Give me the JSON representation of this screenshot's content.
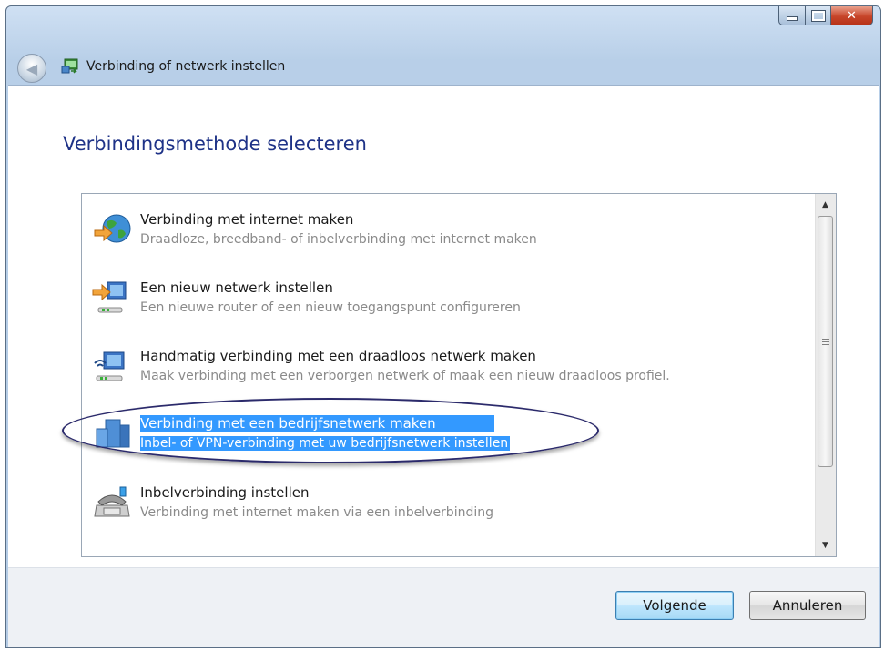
{
  "window": {
    "title": "Verbinding of netwerk instellen",
    "caption_buttons": [
      "minimize",
      "maximize",
      "close"
    ]
  },
  "header": {
    "back_icon": "back-arrow-icon",
    "wizard_icon": "network-setup-icon"
  },
  "main": {
    "heading": "Verbindingsmethode selecteren",
    "options": [
      {
        "title": "Verbinding met internet maken",
        "description": "Draadloze, breedband- of inbelverbinding met internet maken",
        "icon": "internet-globe-icon",
        "selected": false
      },
      {
        "title": "Een nieuw netwerk instellen",
        "description": "Een nieuwe router of een nieuw toegangspunt configureren",
        "icon": "new-network-icon",
        "selected": false
      },
      {
        "title": "Handmatig verbinding met een draadloos netwerk maken",
        "description": "Maak verbinding met een verborgen netwerk of maak een nieuw draadloos profiel.",
        "icon": "wireless-network-icon",
        "selected": false
      },
      {
        "title": "Verbinding met een bedrijfsnetwerk maken",
        "description": "Inbel- of VPN-verbinding met uw bedrijfsnetwerk instellen",
        "icon": "workplace-network-icon",
        "selected": true
      },
      {
        "title": "Inbelverbinding instellen",
        "description": "Verbinding met internet maken via een inbelverbinding",
        "icon": "dialup-phone-icon",
        "selected": false
      }
    ]
  },
  "footer": {
    "next_label": "Volgende",
    "cancel_label": "Annuleren"
  },
  "colors": {
    "selection": "#3399ff",
    "heading": "#1e3287",
    "annotation_ring": "#2b2a6b"
  }
}
